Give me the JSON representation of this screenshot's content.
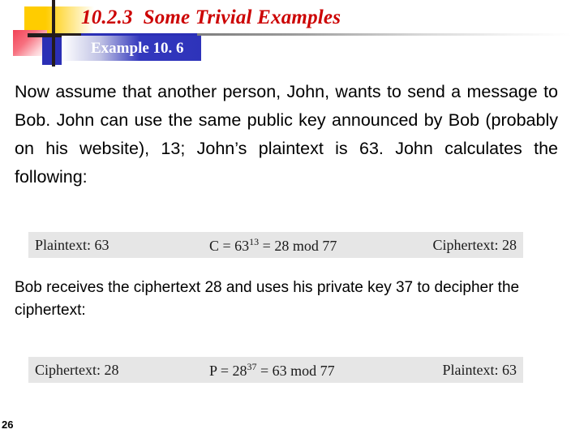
{
  "slide": {
    "title": "10.2.3  Some Trivial Examples",
    "example_label": "Example 10. 6",
    "page_number": "26",
    "paragraph_1": "Now assume that another person, John, wants to send a message to Bob. John can use the same public key announced by Bob (probably on his website), 13; John’s plaintext is 63. John calculates the following:",
    "paragraph_2": "Bob receives the ciphertext 28 and uses his private key 37 to decipher the ciphertext:"
  },
  "formula_boxes": [
    {
      "left": "Plaintext: 63",
      "expr_prefix": "C = 63",
      "expr_exponent": "13",
      "expr_suffix": " = 28 mod 77",
      "right": "Ciphertext: 28"
    },
    {
      "left": "Ciphertext: 28",
      "expr_prefix": "P = 28",
      "expr_exponent": "37",
      "expr_suffix": " = 63 mod 77",
      "right": "Plaintext: 63"
    }
  ],
  "colors": {
    "title_red": "#CC0000",
    "banner_blue": "#2E33BA",
    "deco_yellow": "#FFCC00",
    "deco_red": "#F24256",
    "formula_bg": "#E6E6E6"
  }
}
